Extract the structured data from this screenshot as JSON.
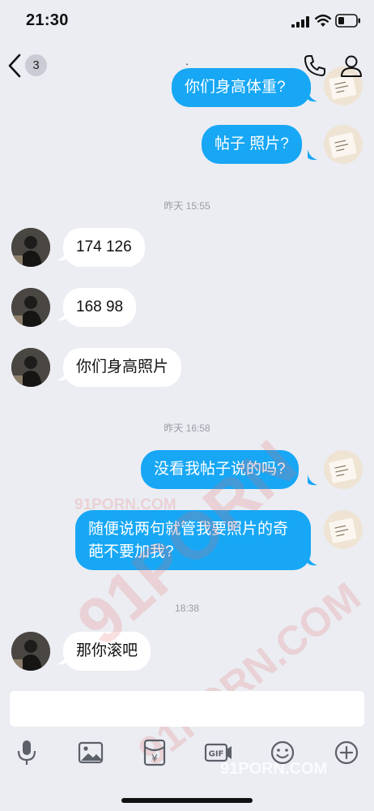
{
  "status": {
    "time": "21:30"
  },
  "nav": {
    "unread_count": "3",
    "title": "."
  },
  "messages": {
    "m0_partial": "你们身高体重?",
    "m1": "帖子 照片?",
    "ts1": "昨天 15:55",
    "m2": "174 126",
    "m3": "168 98",
    "m4": "你们身高照片",
    "ts2": "昨天 16:58",
    "m5": "没看我帖子说的吗?",
    "m6": "随便说两句就管我要照片的奇葩不要加我?",
    "ts3": "18:38",
    "m7": "那你滚吧"
  },
  "watermarks": {
    "w1": "91PORN.COM",
    "w2": "91PORN",
    "w3": "91PORN.COM",
    "w4": "91PORN.COM"
  },
  "colors": {
    "outgoing_bubble": "#17a7f5",
    "incoming_bubble": "#ffffff",
    "background": "#ebedf2"
  },
  "icons": {
    "back": "chevron-left-icon",
    "call": "phone-icon",
    "profile": "contact-icon",
    "voice": "microphone-icon",
    "image": "image-icon",
    "red_packet": "red-packet-icon",
    "gif": "gif-icon",
    "emoji": "emoji-icon",
    "more": "plus-icon"
  }
}
